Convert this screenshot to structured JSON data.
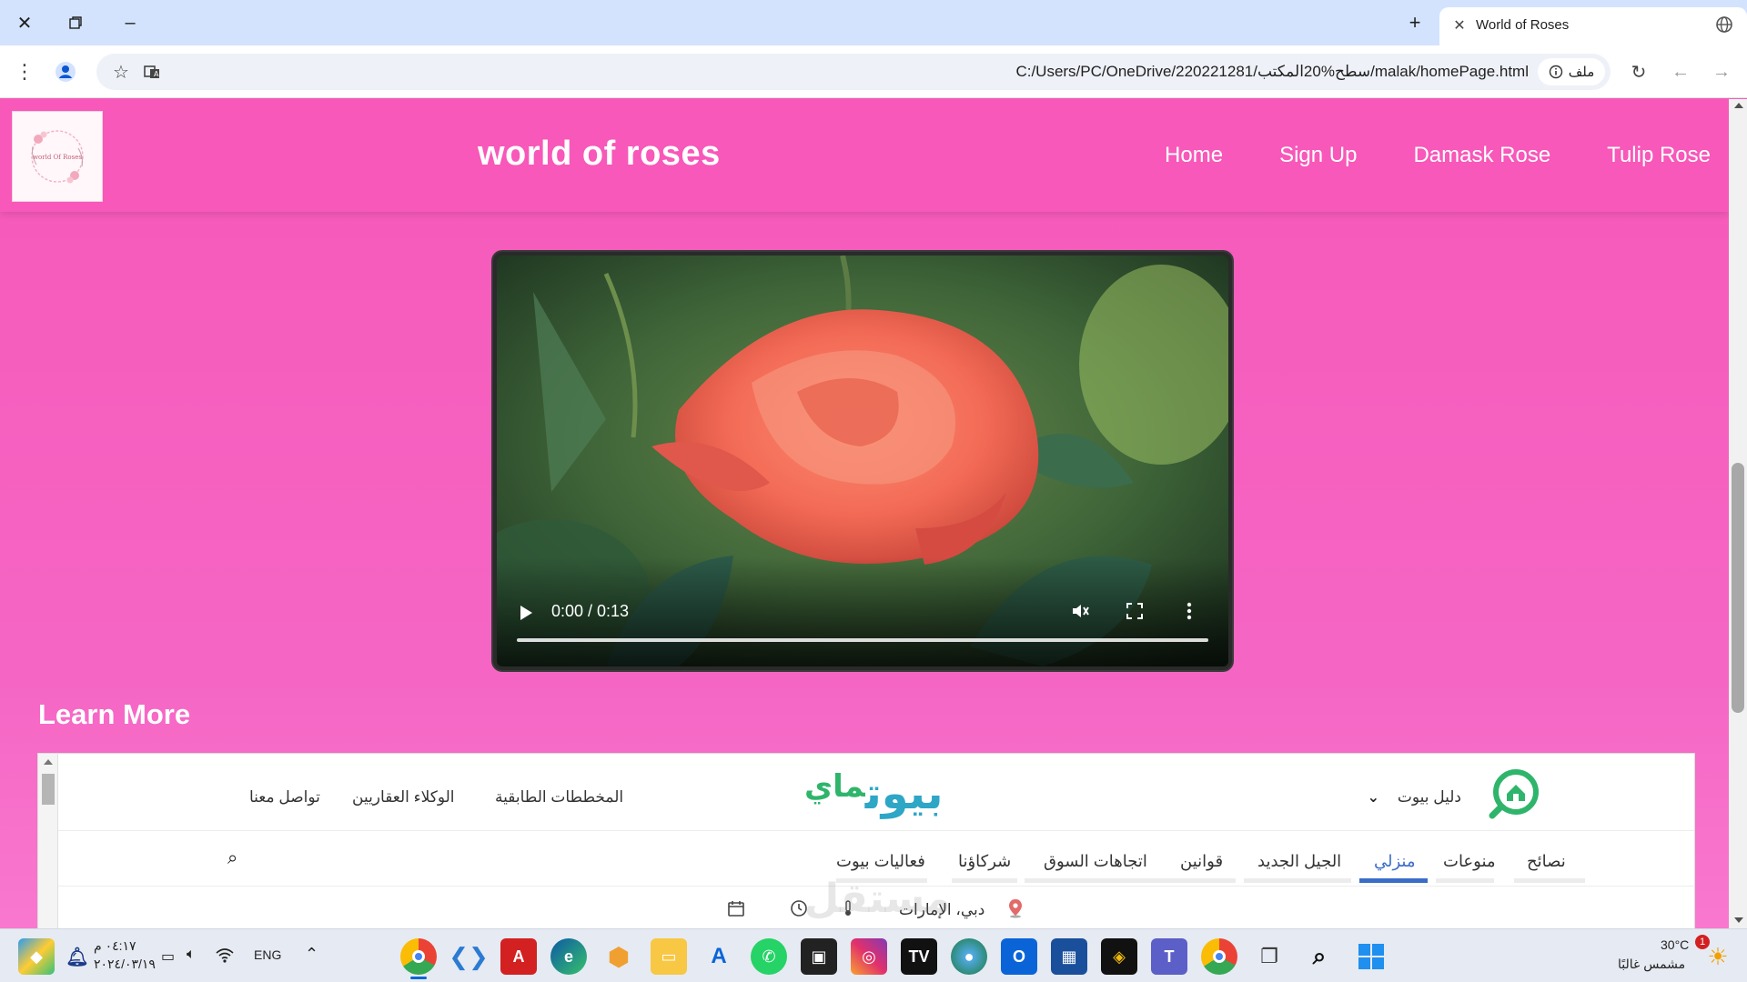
{
  "browser": {
    "tab_title": "World of Roses",
    "url": "C:/Users/PC/OneDrive/220221281/سطح%20المكتب/malak/homePage.html",
    "url_chip": "ملف"
  },
  "site": {
    "logo_text": "world Of Roses",
    "title": "world of roses",
    "nav": [
      "Home",
      "Sign Up",
      "Damask Rose",
      "Tulip Rose"
    ]
  },
  "video": {
    "time_display": "0:00 / 0:13",
    "progress": 0
  },
  "learn_more": {
    "heading": "Learn More"
  },
  "embed": {
    "brand_prefix": "ماي",
    "brand_main": "بيوت",
    "guide_label": "دليل بيوت",
    "top_links": [
      "تواصل معنا",
      "الوكلاء العقاريين",
      "المخططات الطابقية"
    ],
    "menu": [
      "نصائح",
      "منوعات",
      "منزلي",
      "الجيل الجديد",
      "قوانين",
      "اتجاهات السوق",
      "شركاؤنا",
      "فعاليات بيوت"
    ],
    "active_menu": "منزلي",
    "location": "دبي، الإمارات",
    "watermark": "مستقل"
  },
  "taskbar": {
    "clock_time": "٠٤:١٧ م",
    "clock_date": "٢٠٢٤/٠٣/١٩",
    "language": "ENG",
    "weather_temp": "30°C",
    "weather_desc": "مشمس غالبًا",
    "notification_count": "1"
  },
  "colors": {
    "page_pink": "#f758b9",
    "browser_chrome": "#d3e3fd",
    "accent_blue": "#3b6dc8",
    "brand_teal": "#2ea6c6",
    "brand_green": "#2fb56b"
  }
}
